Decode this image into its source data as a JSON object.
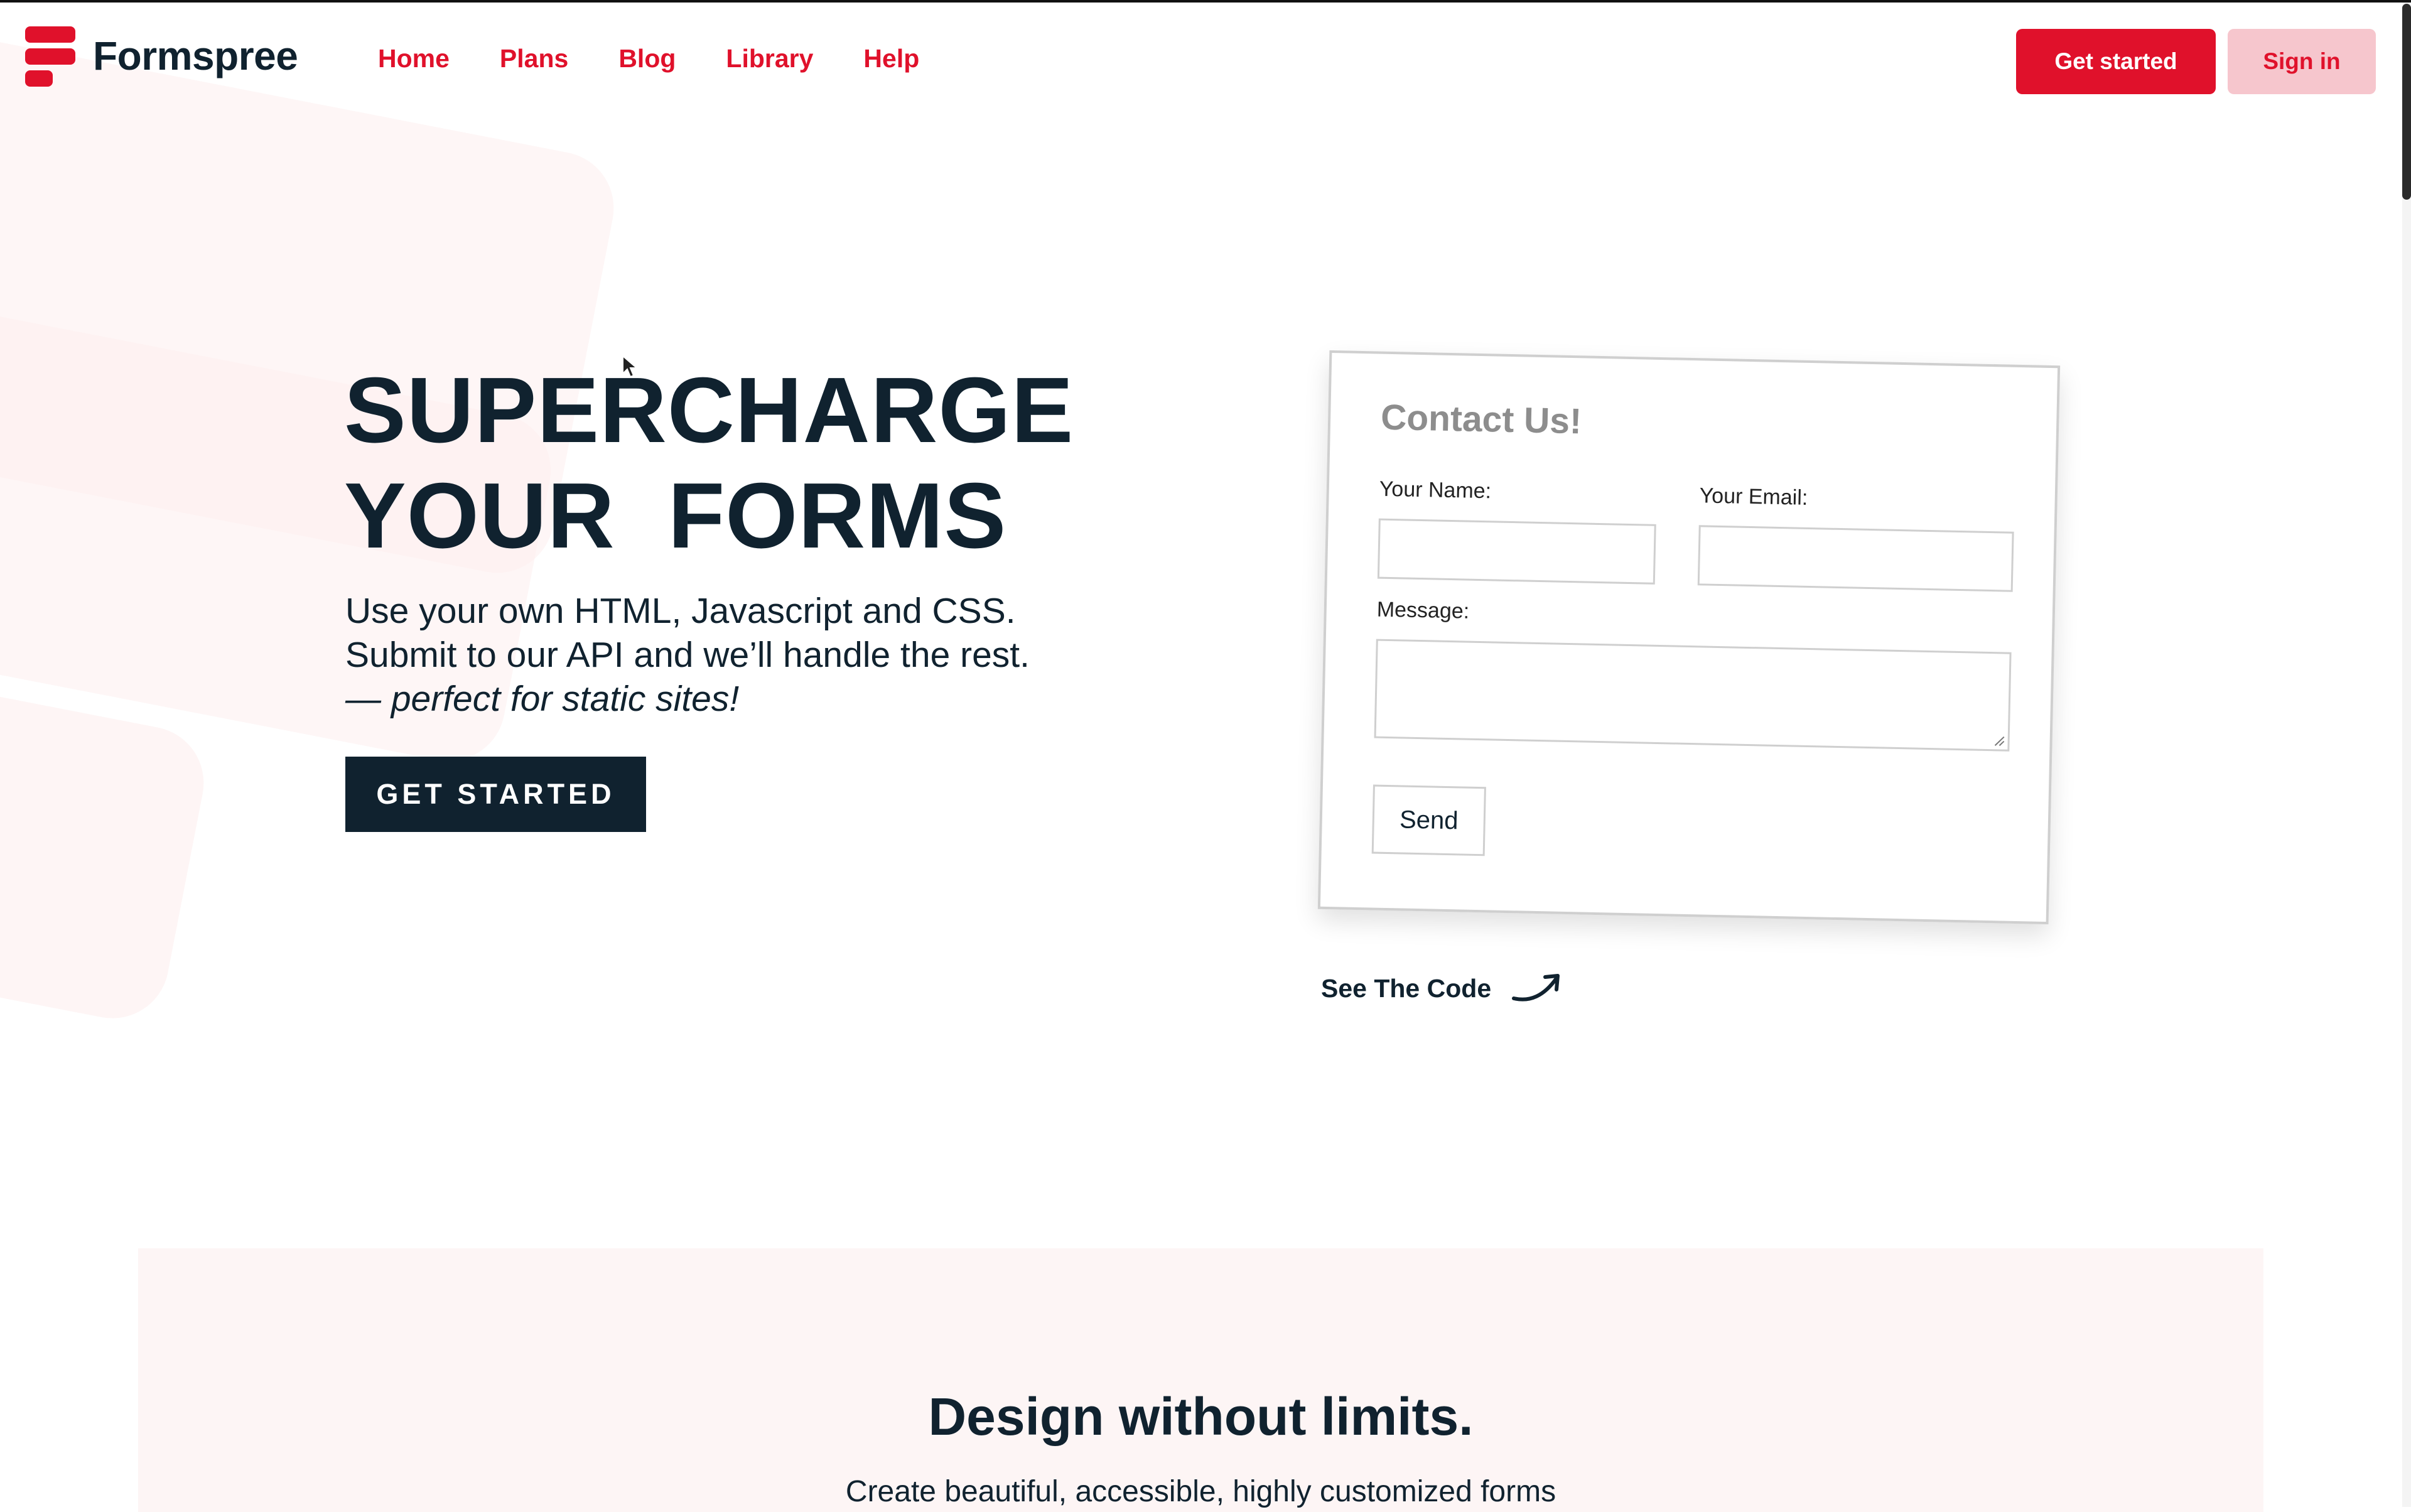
{
  "header": {
    "brand": "Formspree",
    "nav": [
      "Home",
      "Plans",
      "Blog",
      "Library",
      "Help"
    ],
    "get_started_label": "Get started",
    "sign_in_label": "Sign in"
  },
  "hero": {
    "title_line1": "SUPERCHARGE",
    "title_line2": "YOUR  FORMS",
    "line1": "Use your own HTML, Javascript and CSS.",
    "line2": "Submit to our API and we’ll handle the rest.",
    "tagline": "— perfect for static sites!",
    "cta_label": "GET STARTED"
  },
  "contact_form": {
    "title": "Contact Us!",
    "name_label": "Your Name:",
    "email_label": "Your Email:",
    "message_label": "Message:",
    "name_value": "",
    "email_value": "",
    "message_value": "",
    "send_label": "Send"
  },
  "see_code_label": "See The Code",
  "design_section": {
    "title": "Design without limits.",
    "subtitle": "Create beautiful, accessible, highly customized forms"
  },
  "colors": {
    "brand_red": "#e0112b",
    "dark_navy": "#10222f",
    "sign_in_bg": "#f6c6cd",
    "section_bg": "#fdf5f5"
  },
  "icons": {
    "logo": "formspree-logo-icon",
    "arrow": "curved-arrow-icon",
    "cursor": "mouse-pointer-icon"
  }
}
